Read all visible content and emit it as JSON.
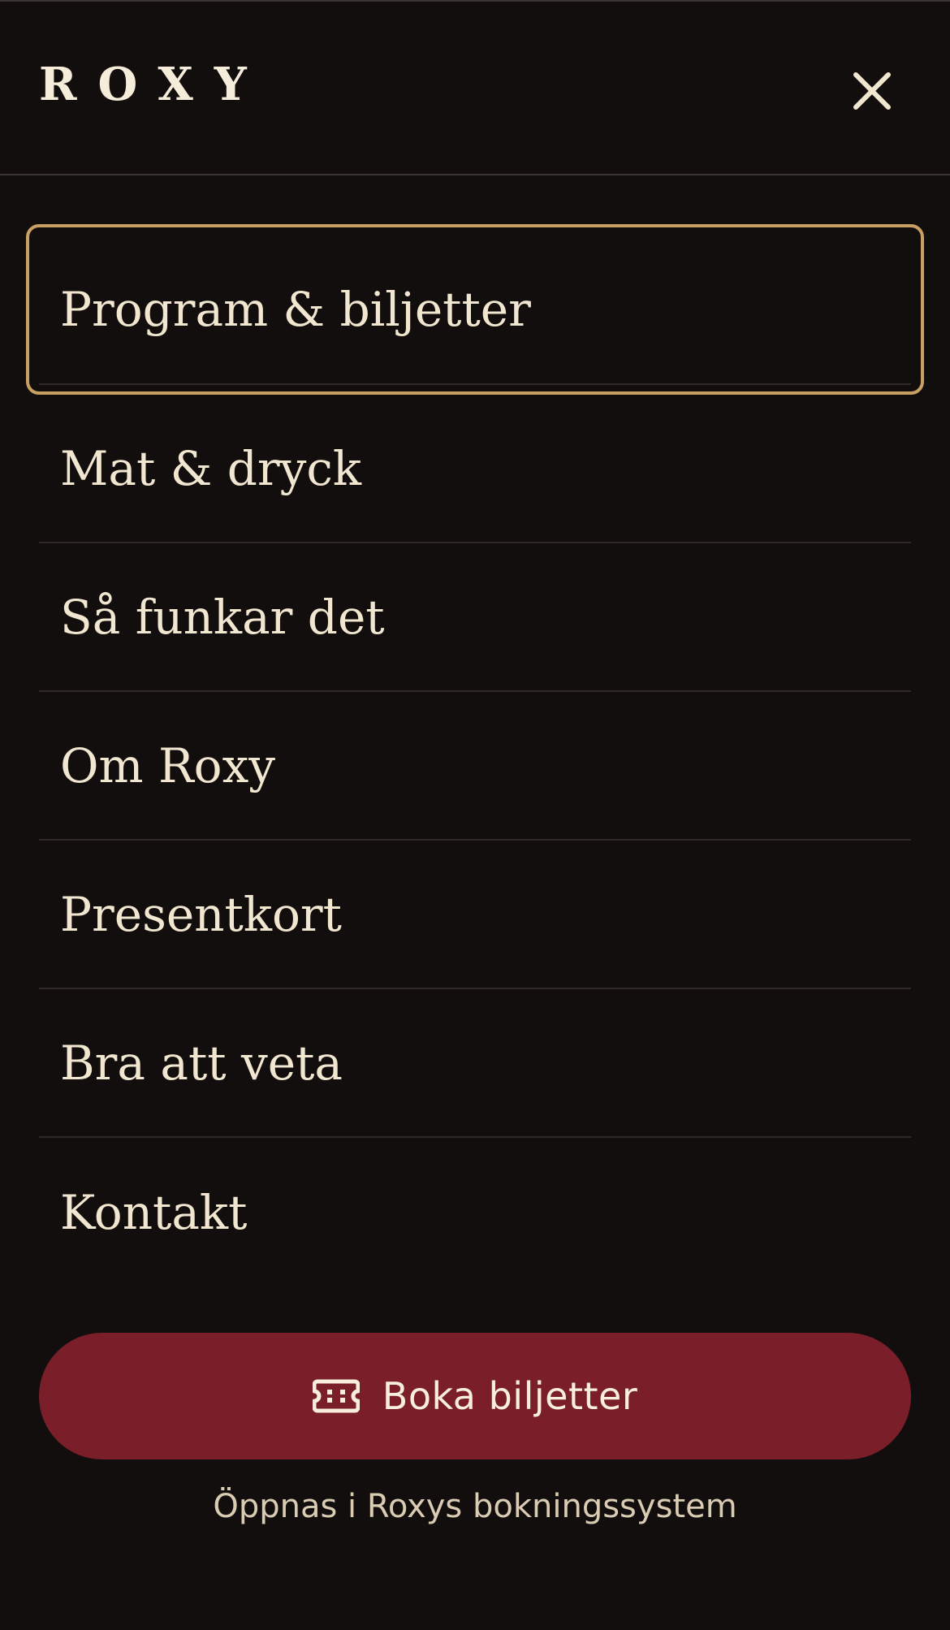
{
  "header": {
    "logo": "ROXY",
    "close_icon": "close-icon"
  },
  "nav": {
    "items": [
      {
        "label": "Program & biljetter",
        "active": true
      },
      {
        "label": "Mat & dryck"
      },
      {
        "label": "Så funkar det"
      },
      {
        "label": "Om Roxy"
      },
      {
        "label": "Presentkort"
      },
      {
        "label": "Bra att veta"
      },
      {
        "label": "Kontakt"
      }
    ]
  },
  "cta": {
    "icon": "ticket-icon",
    "label": "Boka biljetter",
    "note": "Öppnas i Roxys bokningssystem"
  },
  "colors": {
    "background": "#130e0e",
    "text": "#f1e6cf",
    "accent_border": "#c9a063",
    "cta_background": "#7a1f2a"
  }
}
